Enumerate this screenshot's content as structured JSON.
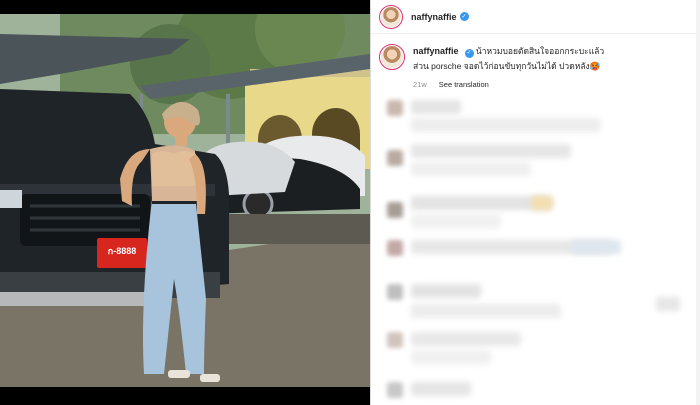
{
  "post": {
    "username": "naffynaffie",
    "verified_icon": "verified-badge-icon",
    "caption_line1": "น้าหวมบอยตัดสินใจออกกระบะแล้ว",
    "caption_line2": "ส่วน porsche จอดไว้ก่อนขับทุกวันไม่ได้ ปวดหลัง🥵",
    "time_ago": "21w",
    "see_translation": "See translation"
  },
  "photo": {
    "plate_text": "ก-8888",
    "subject": "woman leaning on black pickup truck"
  },
  "colors": {
    "verified": "#3897f0",
    "avatar_ring": "#e1306c",
    "muted_text": "#8e8e8e"
  }
}
